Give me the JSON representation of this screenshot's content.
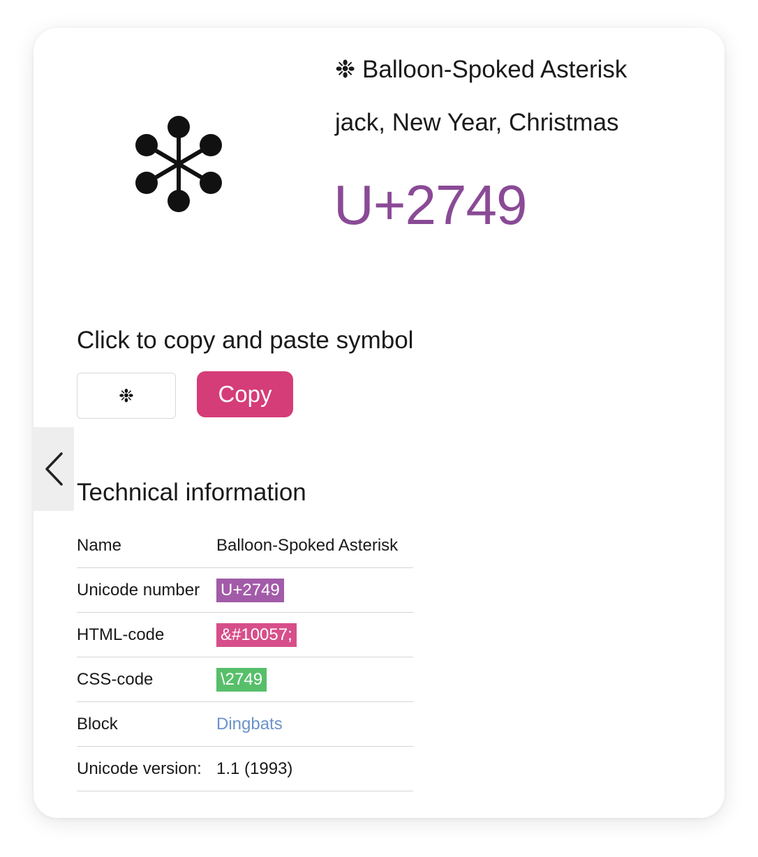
{
  "symbol": "❉",
  "header": {
    "title": "❉ Balloon-Spoked Asterisk",
    "tags": "jack, New Year, Christmas",
    "code": "U+2749"
  },
  "copy": {
    "heading": "Click to copy and paste symbol",
    "value": "❉",
    "button_label": "Copy"
  },
  "nav": {
    "prev_icon": "chevron-left-icon"
  },
  "technical": {
    "heading": "Technical information",
    "rows": [
      {
        "label": "Name",
        "value": "Balloon-Spoked Asterisk"
      },
      {
        "label": "Unicode number",
        "value": "U+2749"
      },
      {
        "label": "HTML-code",
        "value": "&#10057;"
      },
      {
        "label": "CSS-code",
        "value": "\\2749"
      },
      {
        "label": "Block",
        "value": "Dingbats"
      },
      {
        "label": "Unicode version:",
        "value": "1.1 (1993)"
      }
    ]
  },
  "colors": {
    "accent_purple": "#8a4a96",
    "copy_button": "#d43d78",
    "unicode_pill": "#a25ba8",
    "html_pill": "#d64f8a",
    "css_pill": "#57bf6a",
    "link": "#6a93c9"
  }
}
